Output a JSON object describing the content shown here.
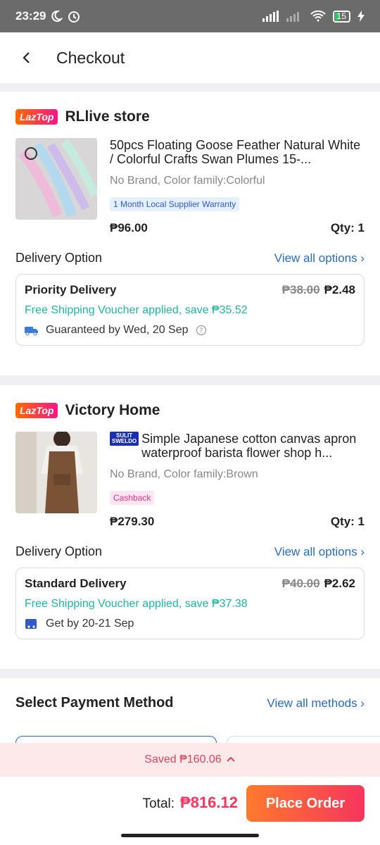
{
  "status_bar": {
    "time": "23:29",
    "battery": "15"
  },
  "header": {
    "title": "Checkout"
  },
  "stores": [
    {
      "badge": "LazTop",
      "name": "RLlive store",
      "product": {
        "title": "50pcs Floating Goose Feather Natural White / Colorful Crafts Swan Plumes 15-...",
        "variant": "No Brand, Color family:Colorful",
        "tag": "1 Month Local Supplier Warranty",
        "price": "₱96.00",
        "qty": "Qty: 1"
      },
      "delivery": {
        "label": "Delivery Option",
        "link": "View all options ›",
        "type": "Priority Delivery",
        "old_fee": "₱38.00",
        "fee": "₱2.48",
        "voucher": "Free Shipping Voucher applied, save ₱35.52",
        "eta": "Guaranteed by Wed, 20 Sep"
      }
    },
    {
      "badge": "LazTop",
      "name": "Victory Home",
      "product": {
        "promo_badge_top": "SULIT",
        "promo_badge_bottom": "SWELDO",
        "title": "Simple Japanese cotton canvas apron waterproof barista flower shop h...",
        "variant": "No Brand, Color family:Brown",
        "tag": "Cashback",
        "price": "₱279.30",
        "qty": "Qty: 1"
      },
      "delivery": {
        "label": "Delivery Option",
        "link": "View all options ›",
        "type": "Standard Delivery",
        "old_fee": "₱40.00",
        "fee": "₱2.62",
        "voucher": "Free Shipping Voucher applied, save ₱37.38",
        "eta": "Get by 20-21 Sep"
      }
    }
  ],
  "payment": {
    "title": "Select Payment Method",
    "link": "View all methods ›"
  },
  "saved": {
    "text": "Saved ₱160.06"
  },
  "footer": {
    "total_label": "Total:",
    "total": "₱816.12",
    "place_order": "Place Order"
  },
  "colors": {
    "accent_blue": "#2a6bc2",
    "voucher_green": "#1fb5a0",
    "price_red": "#f5355e"
  }
}
